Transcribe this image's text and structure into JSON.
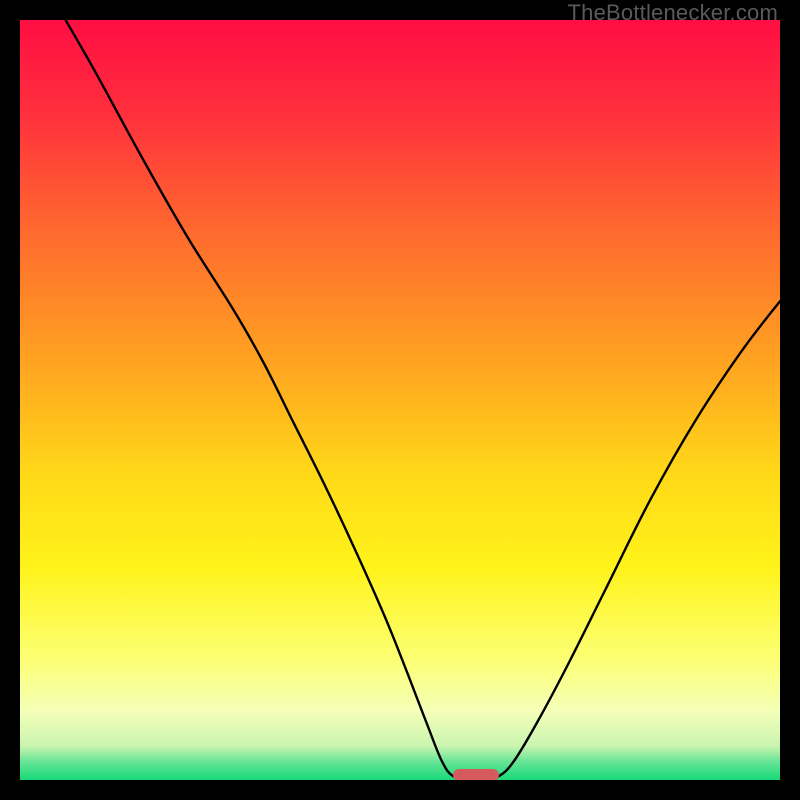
{
  "watermark": "TheBottlenecker.com",
  "chart_data": {
    "type": "line",
    "title": "",
    "xlabel": "",
    "ylabel": "",
    "xlim": [
      0,
      100
    ],
    "ylim": [
      0,
      100
    ],
    "gradient_stops": [
      {
        "pos": 0.0,
        "color": "#ff0e43"
      },
      {
        "pos": 0.12,
        "color": "#ff2e3d"
      },
      {
        "pos": 0.28,
        "color": "#ff6a2e"
      },
      {
        "pos": 0.45,
        "color": "#ffa321"
      },
      {
        "pos": 0.6,
        "color": "#ffd918"
      },
      {
        "pos": 0.72,
        "color": "#fff31a"
      },
      {
        "pos": 0.84,
        "color": "#fcff73"
      },
      {
        "pos": 0.91,
        "color": "#f4ffb8"
      },
      {
        "pos": 0.955,
        "color": "#caf5b0"
      },
      {
        "pos": 0.975,
        "color": "#6be596"
      },
      {
        "pos": 1.0,
        "color": "#18d97a"
      }
    ],
    "series": [
      {
        "name": "bottleneck-curve",
        "points": [
          {
            "x": 6.0,
            "y": 100.0
          },
          {
            "x": 10.0,
            "y": 93.0
          },
          {
            "x": 16.0,
            "y": 82.0
          },
          {
            "x": 22.0,
            "y": 71.5
          },
          {
            "x": 28.0,
            "y": 62.0
          },
          {
            "x": 32.0,
            "y": 55.0
          },
          {
            "x": 36.0,
            "y": 47.0
          },
          {
            "x": 40.0,
            "y": 39.0
          },
          {
            "x": 44.0,
            "y": 30.5
          },
          {
            "x": 48.0,
            "y": 21.5
          },
          {
            "x": 51.0,
            "y": 14.0
          },
          {
            "x": 53.5,
            "y": 7.5
          },
          {
            "x": 55.5,
            "y": 2.5
          },
          {
            "x": 57.0,
            "y": 0.5
          },
          {
            "x": 59.0,
            "y": 0.2
          },
          {
            "x": 61.0,
            "y": 0.2
          },
          {
            "x": 63.0,
            "y": 0.5
          },
          {
            "x": 65.0,
            "y": 2.5
          },
          {
            "x": 68.0,
            "y": 7.5
          },
          {
            "x": 72.0,
            "y": 15.0
          },
          {
            "x": 77.0,
            "y": 25.0
          },
          {
            "x": 83.0,
            "y": 37.0
          },
          {
            "x": 89.0,
            "y": 47.5
          },
          {
            "x": 95.0,
            "y": 56.5
          },
          {
            "x": 100.0,
            "y": 63.0
          }
        ]
      }
    ],
    "marker": {
      "x_center": 60.0,
      "width_pct": 6.0,
      "color": "#d45a5e"
    }
  }
}
